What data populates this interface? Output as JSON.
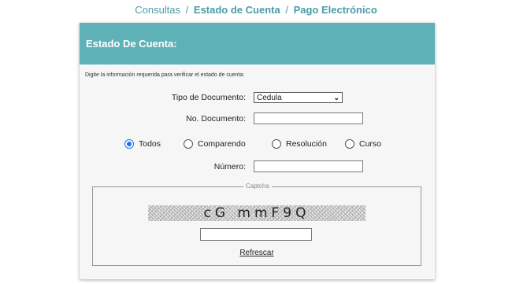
{
  "breadcrumb": {
    "part1": "Consultas",
    "sep1": "/",
    "part2": "Estado de Cuenta",
    "sep2": "/",
    "part3": "Pago Electrónico"
  },
  "panel": {
    "title": "Estado De Cuenta:",
    "instructions": "Digite la información requerida para verificar el estado de cuenta:"
  },
  "form": {
    "tipo_documento": {
      "label": "Tipo de Documento:",
      "value": "Cedula"
    },
    "no_documento": {
      "label": "No. Documento:",
      "value": ""
    },
    "radios": [
      {
        "label": "Todos",
        "checked": true
      },
      {
        "label": "Comparendo",
        "checked": false
      },
      {
        "label": "Resolución",
        "checked": false
      },
      {
        "label": "Curso",
        "checked": false
      }
    ],
    "numero": {
      "label": "Número:",
      "value": ""
    }
  },
  "captcha": {
    "legend": "Captcha",
    "text": "cG mmF9Q",
    "input_value": "",
    "refresh_label": "Refrescar"
  },
  "colors": {
    "accent": "#5fb1b8",
    "breadcrumb": "#4a9ca8",
    "radio_selected": "#1a73e8"
  },
  "icons": {
    "select_arrow": "chevron-down-icon"
  }
}
